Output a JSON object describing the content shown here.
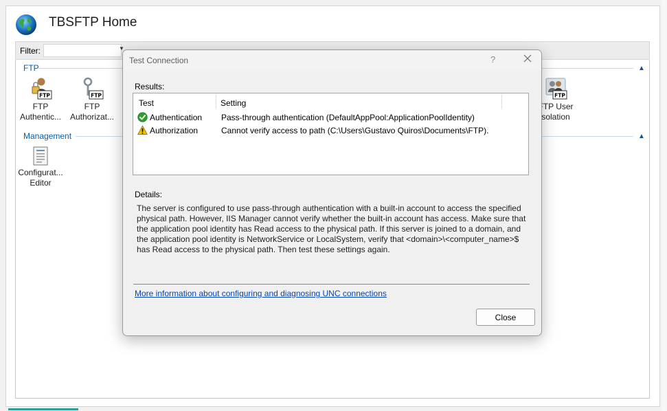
{
  "home": {
    "title": "TBSFTP Home",
    "filter_label": "Filter:",
    "groups": {
      "ftp": "FTP",
      "management": "Management"
    },
    "features": [
      {
        "line1": "FTP",
        "line2": "Authentic...",
        "icon": "ftp-authentication-icon"
      },
      {
        "line1": "FTP",
        "line2": "Authorizat...",
        "icon": "ftp-authorization-icon"
      },
      {
        "line1": "FTP User",
        "line2": "solation",
        "icon": "ftp-user-isolation-icon"
      },
      {
        "line1": "Configurat...",
        "line2": "Editor",
        "icon": "configuration-editor-icon"
      }
    ]
  },
  "dialog": {
    "title": "Test Connection",
    "help": "?",
    "results_label": "Results:",
    "columns": {
      "test": "Test",
      "setting": "Setting"
    },
    "results": [
      {
        "status": "success",
        "test": "Authentication",
        "setting": "Pass-through authentication (DefaultAppPool:ApplicationPoolIdentity)"
      },
      {
        "status": "warning",
        "test": "Authorization",
        "setting": "Cannot verify access to path (C:\\Users\\Gustavo Quiros\\Documents\\FTP)."
      }
    ],
    "details_label": "Details:",
    "details_text": "The server is configured to use pass-through authentication with a built-in account to access the specified\nphysical path. However, IIS Manager cannot verify whether the built-in account has access. Make sure that\nthe application pool identity has Read access to the physical path. If this server is joined to a domain, and\nthe application pool identity is NetworkService or LocalSystem, verify that <domain>\\<computer_name>$\nhas Read access to the physical path. Then test these settings again.",
    "more_info_link": "More information about configuring and diagnosing UNC connections",
    "close_button": "Close"
  },
  "colors": {
    "group_header": "#0a5ca8",
    "link": "#0645ad",
    "success": "#2e9e2e",
    "warning": "#f2c200"
  }
}
